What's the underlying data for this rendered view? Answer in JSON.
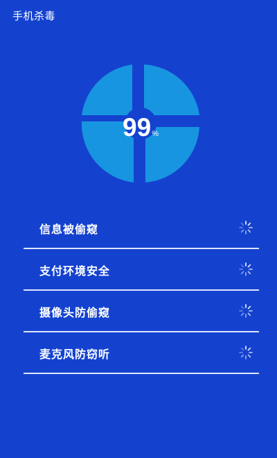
{
  "header": {
    "title": "手机杀毒"
  },
  "gauge": {
    "value": "99",
    "unit": "%",
    "segment_color": "#1895e0",
    "icon": "scan-gauge"
  },
  "checks": [
    {
      "label": "信息被偷窥",
      "status_icon": "loading-spinner-icon"
    },
    {
      "label": "支付环境安全",
      "status_icon": "loading-spinner-icon"
    },
    {
      "label": "摄像头防偷窥",
      "status_icon": "loading-spinner-icon"
    },
    {
      "label": "麦克风防窃听",
      "status_icon": "loading-spinner-icon"
    }
  ],
  "colors": {
    "background": "#1442cf",
    "text": "#ffffff",
    "divider": "#dfe6ff"
  }
}
